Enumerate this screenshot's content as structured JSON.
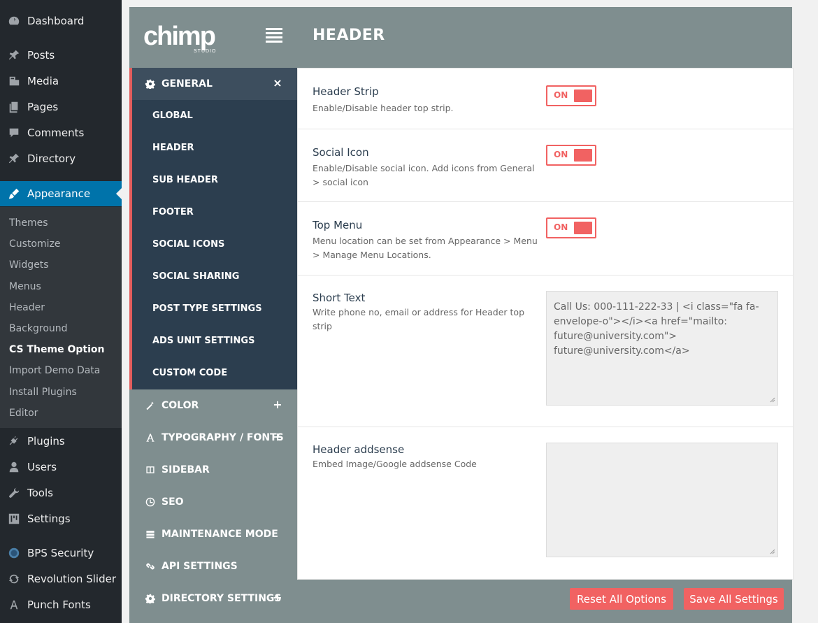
{
  "wp_menu": {
    "items_top": [
      {
        "label": "Dashboard",
        "icon": "dashboard-icon"
      },
      {
        "label": "Posts",
        "icon": "pin-icon"
      },
      {
        "label": "Media",
        "icon": "media-icon"
      },
      {
        "label": "Pages",
        "icon": "pages-icon"
      },
      {
        "label": "Comments",
        "icon": "comment-icon"
      },
      {
        "label": "Directory",
        "icon": "pin-icon"
      },
      {
        "label": "Appearance",
        "icon": "brush-icon"
      }
    ],
    "submenu": [
      "Themes",
      "Customize",
      "Widgets",
      "Menus",
      "Header",
      "Background",
      "CS Theme Option",
      "Import Demo Data",
      "Install Plugins",
      "Editor"
    ],
    "items_bottom": [
      {
        "label": "Plugins",
        "icon": "plug-icon"
      },
      {
        "label": "Users",
        "icon": "user-icon"
      },
      {
        "label": "Tools",
        "icon": "wrench-icon"
      },
      {
        "label": "Settings",
        "icon": "sliders-icon"
      },
      {
        "label": "BPS Security",
        "icon": "shield-globe-icon"
      },
      {
        "label": "Revolution Slider",
        "icon": "refresh-icon"
      },
      {
        "label": "Punch Fonts",
        "icon": "letter-a-icon"
      }
    ]
  },
  "panel": {
    "logo_text": "chimp",
    "logo_subtext": "STUDIO",
    "title": "HEADER"
  },
  "nav": {
    "general": {
      "label": "GENERAL",
      "icon": "gear-icon",
      "toggle": "×"
    },
    "general_items": [
      "GLOBAL",
      "HEADER",
      "SUB HEADER",
      "FOOTER",
      "SOCIAL ICONS",
      "SOCIAL SHARING",
      "POST TYPE SETTINGS",
      "ADS UNIT SETTINGS",
      "CUSTOM CODE"
    ],
    "groups": [
      {
        "label": "COLOR",
        "icon": "magic-wand-icon",
        "toggle": "+"
      },
      {
        "label": "TYPOGRAPHY / FONTS",
        "icon": "font-icon",
        "toggle": "+"
      },
      {
        "label": "SIDEBAR",
        "icon": "columns-icon",
        "toggle": ""
      },
      {
        "label": "SEO",
        "icon": "seo-icon",
        "toggle": ""
      },
      {
        "label": "MAINTENANCE MODE",
        "icon": "server-icon",
        "toggle": ""
      },
      {
        "label": "API SETTINGS",
        "icon": "link-icon",
        "toggle": ""
      },
      {
        "label": "DIRECTORY SETTINGS",
        "icon": "gear-icon",
        "toggle": "+"
      }
    ]
  },
  "settings": {
    "header_strip": {
      "label": "Header Strip",
      "desc": "Enable/Disable header top strip.",
      "value": "ON"
    },
    "social_icon": {
      "label": "Social Icon",
      "desc": "Enable/Disable social icon. Add icons from General > social icon",
      "value": "ON"
    },
    "top_menu": {
      "label": "Top Menu",
      "desc": "Menu location can be set from Appearance > Menu > Manage Menu Locations.",
      "value": "ON"
    },
    "short_text": {
      "label": "Short Text",
      "desc": "Write phone no, email or address for Header top strip",
      "value": "Call Us: 000-111-222-33 | <i class=\"fa fa-envelope-o\"></i><a href=\"mailto: future@university.com\"> future@university.com</a>"
    },
    "header_addsense": {
      "label": "Header addsense",
      "desc": "Embed Image/Google addsense Code",
      "value": ""
    }
  },
  "buttons": {
    "reset": "Reset All Options",
    "save": "Save All Settings"
  },
  "colors": {
    "accent": "#f16262",
    "panel": "#7f8e8f",
    "nav_dark": "#2c3e4f",
    "wp_active": "#0073aa"
  }
}
